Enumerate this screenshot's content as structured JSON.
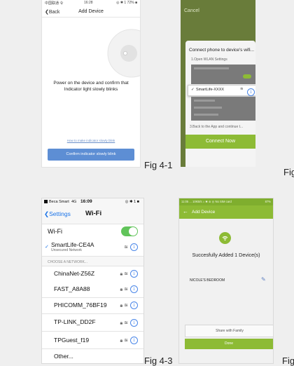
{
  "fig1": {
    "status": {
      "carrier": "中国联通 令",
      "time": "16:28",
      "right": "◎ ✱ 1 72% ■"
    },
    "nav": {
      "back": "Back",
      "title": "Add Device"
    },
    "instruction": "Power on the device and confirm that Indicator light slowly blinks",
    "help_link": "How to make indicator slowly blink",
    "confirm_button": "Confirm indicator slowly blink",
    "caption": "Fig 4-1"
  },
  "fig2": {
    "cancel": "Cancel",
    "dialog_title": "Connect phone to device's wifi...",
    "step1": "1.Open WLAN Settings",
    "network": "SmartLife-XXXX",
    "step3": "3.Back to the App and continue t...",
    "connect_button": "Connect Now",
    "caption_partial": "Fig"
  },
  "fig3": {
    "status": {
      "carrier": "Beca Smart",
      "signal": "4G",
      "time": "16:09",
      "right": "◎ ✱ 1 ■"
    },
    "nav": {
      "back": "Settings",
      "title": "Wi-Fi"
    },
    "wifi_label": "Wi-Fi",
    "connected": {
      "name": "SmartLife-CE4A",
      "sub": "Unsecured Network"
    },
    "section_header": "CHOOSE A NETWORK...",
    "networks": [
      "ChinaNet-Z56Z",
      "FAST_A8A88",
      "PHICOMM_76BF19",
      "TP-LINK_DD2F",
      "TPGuest_f19",
      "Other..."
    ],
    "caption": "Fig 4-3"
  },
  "fig4": {
    "status": {
      "left": "11:05 ... 10KB/s ⌂ ✱ ⊜ ◎ No SIM card",
      "right": "87%"
    },
    "nav_title": "Add Device",
    "success": "Succesfully Added 1 Device(s)",
    "device_name": "NICOLE'S BEDROOM",
    "share_button": "Share with Family",
    "done_button": "Done",
    "caption_partial": "Fig"
  },
  "colors": {
    "brand_green": "#8dbb35",
    "ios_blue": "#4a86e8",
    "button_blue": "#5d8ed4"
  }
}
